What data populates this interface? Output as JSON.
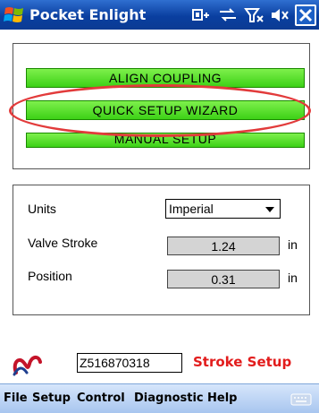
{
  "titlebar": {
    "title": "Pocket Enlight",
    "icons": [
      "windows-logo-icon",
      "connectivity-icon",
      "network-sync-icon",
      "signal-off-icon",
      "volume-muted-icon",
      "close-icon"
    ]
  },
  "setup_group": {
    "buttons": [
      {
        "label": "ALIGN COUPLING"
      },
      {
        "label": "QUICK SETUP WIZARD"
      },
      {
        "label": "MANUAL SETUP"
      }
    ],
    "highlight_color": "#e23b3b",
    "button_color": "#4ce01e"
  },
  "settings_group": {
    "units": {
      "label": "Units",
      "selected": "Imperial"
    },
    "valve_stroke": {
      "label": "Valve Stroke",
      "value": "1.24",
      "unit": "in"
    },
    "position": {
      "label": "Position",
      "value": "0.31",
      "unit": "in"
    }
  },
  "status": {
    "serial": "Z516870318",
    "screen_name": "Stroke Setup",
    "screen_name_color": "#e21c1c"
  },
  "menubar": {
    "items": [
      {
        "label": "File"
      },
      {
        "label": "Setup"
      },
      {
        "label": "Control"
      },
      {
        "label": "Diagnostic"
      },
      {
        "label": "Help"
      }
    ]
  }
}
